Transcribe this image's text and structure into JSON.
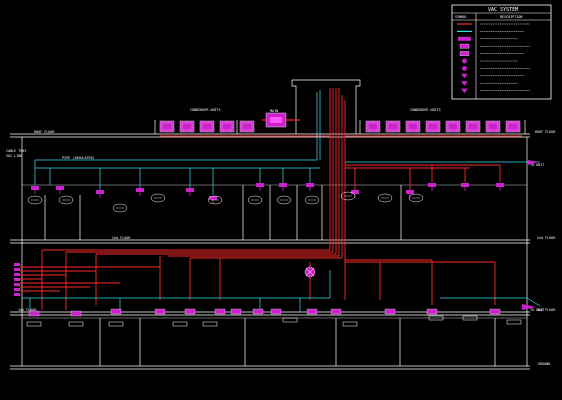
{
  "legend": {
    "title": "VAC SYSTEM",
    "col_symbol": "SYMBOL",
    "col_description": "DESCRIPTION",
    "rows": [
      {
        "color": "#ff2a2a",
        "style": "line"
      },
      {
        "color": "#33e0f0",
        "style": "line"
      },
      {
        "color": "#cc22cc",
        "style": "hatch"
      },
      {
        "color": "#cc22cc",
        "style": "block"
      },
      {
        "color": "#cc22cc",
        "style": "block"
      },
      {
        "color": "#cc22cc",
        "style": "valve"
      },
      {
        "color": "#cc22cc",
        "style": "valve"
      },
      {
        "color": "#cc22cc",
        "style": "drop"
      },
      {
        "color": "#cc22cc",
        "style": "drop"
      },
      {
        "color": "#cc22cc",
        "style": "drop"
      }
    ]
  },
  "floor_labels": {
    "roof_left": "ROOF FLOOR",
    "roof_right": "ROOF FLOOR",
    "second_left": "2nd FLOOR",
    "second_right": "2nd FLOOR",
    "first_left": "1st FLOOR",
    "first_right": "1st FLOOR",
    "ground": "GROUND"
  },
  "annotations": {
    "condenser_left": "CONDENSER UNITS",
    "condenser_right": "CONDENSER UNITS",
    "main_riser": "MAIN",
    "feed_left": "CABLE TRAY",
    "feed_sub": "VAC LINE",
    "pipe_label": "PIPE (INSULATED)",
    "to_left": "TO AHU",
    "to_right": "TO UNIT",
    "to_right_2": "TO UNIT"
  },
  "colors": {
    "refrigerant": "#ff2a2a",
    "drain": "#33e0f0",
    "equipment": "#cc22cc",
    "outline": "#ffffff"
  }
}
